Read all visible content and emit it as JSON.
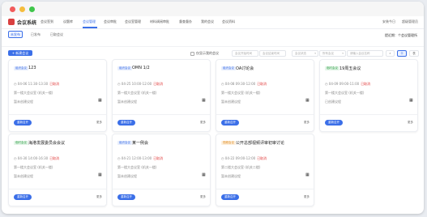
{
  "app": {
    "brand": "会议系统"
  },
  "nav": {
    "items": [
      {
        "label": "会议签到",
        "active": false
      },
      {
        "label": "议题库",
        "active": false
      },
      {
        "label": "会议管理",
        "active": true
      },
      {
        "label": "会议审批",
        "active": false
      },
      {
        "label": "会议室管理",
        "active": false
      },
      {
        "label": "材料调阅审批",
        "active": false
      },
      {
        "label": "督查督办",
        "active": false
      },
      {
        "label": "我的会议",
        "active": false
      },
      {
        "label": "会议资料",
        "active": false
      }
    ],
    "right": {
      "install": "安装今日",
      "user": "超级管理员"
    }
  },
  "subtabs": {
    "items": [
      "未发布",
      "已发布",
      "已取会议"
    ],
    "active_index": 0,
    "right_text": "提近期：个会议管理所"
  },
  "filters": {
    "new_button": "+ 新建会议",
    "checkbox_label": "仅显示我的会议",
    "select1": "会议开始时间",
    "select2": "会议结束时间",
    "select3": "会议状态",
    "select4": "所有会议",
    "search_placeholder": "请输入会议名称",
    "toggle_card": "卡",
    "toggle_list": "表"
  },
  "cards": [
    {
      "type_label": "组织会议",
      "type_color": "blue",
      "title": "123",
      "time": "04-06 11:30-13:30",
      "status": "已取消",
      "room": "第一楼大会议室 (机关一楼)",
      "note": "暂未创建议程",
      "enter_label": "重新召开",
      "more_label": "更多"
    },
    {
      "type_label": "组织会议",
      "type_color": "blue",
      "title": "OMN 1/2",
      "time": "04-25 10:00-12:00",
      "status": "已取消",
      "room": "第一楼大会议室 (机关一楼)",
      "note": "暂未创建议程",
      "enter_label": "重新召开",
      "more_label": "更多"
    },
    {
      "type_label": "组织会议",
      "type_color": "blue",
      "title": "OA讨论会",
      "time": "04-08 09:30-12:00",
      "status": "已取消",
      "room": "第一楼大会议室 (机关一楼)",
      "note": "暂未创建议程",
      "enter_label": "重新召开",
      "more_label": "更多"
    },
    {
      "type_label": "临时会议",
      "type_color": "green",
      "title": "19周五会议",
      "time": "04-09 09:00-11:00",
      "status": "已取消",
      "room": "第一楼大会议室 (机关一楼)",
      "note": "已创建议程",
      "enter_label": "重新召开",
      "more_label": "更多"
    },
    {
      "type_label": "临时会议",
      "type_color": "green",
      "title": "海港发展委员会会议",
      "time": "04-30 14:00-16:30",
      "status": "已取消",
      "room": "第一楼大会议室 (机关一楼)",
      "note": "暂未创建议程",
      "enter_label": "重新召开",
      "more_label": "更多"
    },
    {
      "type_label": "组织会议",
      "type_color": "blue",
      "title": "某一例会",
      "time": "04-21 12:00-13:00",
      "status": "已取消",
      "room": "第一楼大会议室 (机关一楼)",
      "note": "暂未创建议程",
      "enter_label": "重新召开",
      "more_label": "更多"
    },
    {
      "type_label": "视频会议",
      "type_color": "orange",
      "title": "公开总部视频评审初审讨论",
      "time": "04-22 09:00-12:00",
      "status": "已取消",
      "room": "第二楼大会议室 (机关二楼)",
      "note": "暂未创建议程",
      "enter_label": "重新召开",
      "more_label": "更多"
    }
  ]
}
